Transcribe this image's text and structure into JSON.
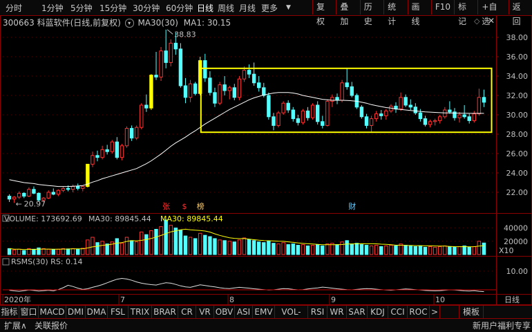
{
  "toolbar": {
    "periods": [
      "分时",
      "1分钟",
      "5分钟",
      "15分钟",
      "30分钟",
      "60分钟",
      "日线",
      "周线",
      "月线",
      "更多"
    ],
    "active_period": "日线",
    "right_buttons": [
      "复权",
      "叠加",
      "历史",
      "统计",
      "画线",
      "F10",
      "标记",
      "+自选",
      "返回"
    ]
  },
  "info": {
    "stock": "300663 科蓝软件(日线,前复权)",
    "ma_label": "MA30(30)",
    "ma_value": "MA1: 30.15"
  },
  "chart_labels": {
    "high_label": "38.83",
    "low_label": "20.97",
    "markers": [
      {
        "text": "张",
        "color": "#ff3333"
      },
      {
        "text": "$",
        "color": "#ff3333"
      },
      {
        "text": "榜",
        "color": "#ffcc66"
      },
      {
        "text": "财",
        "color": "#66ccff"
      }
    ],
    "volume_line": "VOLUME: 173692.69  MA30: 89845.44",
    "volume_ma2": "MA30: 89845.44",
    "rsms_line": "RSMS(30)  RS: 0.14",
    "x10": "X10",
    "months": [
      "2020年",
      "7",
      "8",
      "9",
      "10"
    ],
    "right_corner": "日线",
    "vol_axis": [
      "40000",
      "20000"
    ],
    "rs_axis": [
      "10.00"
    ]
  },
  "chart_data": {
    "type": "candlestick",
    "title": "300663 科蓝软件(日线,前复权)",
    "ylim": [
      20,
      39
    ],
    "y_ticks": [
      38,
      36,
      34,
      32,
      30,
      28,
      26,
      24,
      22
    ],
    "candles": [
      [
        21.6,
        21.8,
        21.0,
        21.3
      ],
      [
        21.3,
        21.6,
        20.9,
        21.5
      ],
      [
        21.5,
        22.1,
        21.3,
        21.9
      ],
      [
        21.9,
        22.0,
        21.4,
        21.6
      ],
      [
        21.6,
        22.5,
        21.5,
        22.3
      ],
      [
        22.3,
        22.6,
        21.8,
        21.9
      ],
      [
        21.9,
        22.0,
        21.0,
        21.2
      ],
      [
        21.2,
        21.5,
        20.97,
        21.4
      ],
      [
        21.4,
        22.2,
        21.3,
        22.0
      ],
      [
        22.0,
        22.4,
        21.7,
        21.8
      ],
      [
        21.8,
        22.3,
        21.6,
        22.2
      ],
      [
        22.2,
        22.6,
        22.0,
        22.4
      ],
      [
        22.4,
        22.7,
        22.1,
        22.3
      ],
      [
        22.3,
        22.8,
        22.0,
        22.6
      ],
      [
        22.6,
        22.9,
        22.2,
        22.4
      ],
      [
        22.4,
        22.7,
        22.1,
        22.6
      ],
      [
        22.6,
        24.9,
        22.5,
        24.9
      ],
      [
        24.9,
        26.2,
        24.6,
        25.8
      ],
      [
        25.8,
        26.3,
        25.2,
        25.6
      ],
      [
        25.6,
        26.8,
        25.4,
        26.4
      ],
      [
        26.4,
        26.9,
        25.9,
        26.2
      ],
      [
        26.2,
        27.4,
        26.0,
        27.2
      ],
      [
        27.2,
        27.7,
        25.4,
        25.6
      ],
      [
        25.6,
        27.0,
        25.3,
        26.8
      ],
      [
        26.8,
        28.8,
        26.6,
        28.6
      ],
      [
        28.6,
        28.9,
        27.3,
        27.6
      ],
      [
        27.6,
        28.9,
        27.4,
        28.7
      ],
      [
        28.7,
        31.2,
        28.5,
        31.0
      ],
      [
        31.0,
        32.1,
        30.3,
        30.7
      ],
      [
        30.7,
        34.2,
        30.5,
        34.1
      ],
      [
        34.1,
        36.5,
        33.6,
        33.9
      ],
      [
        33.9,
        37.0,
        33.5,
        36.6
      ],
      [
        36.6,
        38.8,
        34.8,
        35.4
      ],
      [
        35.4,
        37.8,
        35.0,
        37.4
      ],
      [
        37.4,
        38.5,
        36.2,
        36.8
      ],
      [
        36.8,
        37.4,
        32.8,
        33.0
      ],
      [
        33.0,
        33.8,
        31.2,
        31.8
      ],
      [
        31.8,
        33.6,
        31.3,
        33.2
      ],
      [
        33.2,
        33.4,
        32.0,
        32.2
      ],
      [
        32.2,
        36.0,
        32.0,
        35.6
      ],
      [
        35.6,
        36.3,
        33.4,
        33.8
      ],
      [
        33.8,
        34.5,
        32.0,
        32.3
      ],
      [
        32.3,
        32.8,
        30.8,
        31.2
      ],
      [
        31.2,
        33.4,
        31.0,
        33.1
      ],
      [
        33.1,
        34.0,
        32.0,
        32.5
      ],
      [
        32.5,
        33.0,
        31.6,
        32.8
      ],
      [
        32.8,
        33.2,
        31.5,
        31.8
      ],
      [
        31.8,
        34.0,
        31.5,
        33.7
      ],
      [
        33.7,
        35.0,
        33.4,
        34.6
      ],
      [
        34.6,
        35.2,
        33.8,
        34.2
      ],
      [
        34.2,
        35.4,
        33.0,
        33.3
      ],
      [
        33.3,
        34.0,
        32.4,
        32.8
      ],
      [
        32.8,
        33.3,
        31.8,
        32.0
      ],
      [
        32.0,
        32.3,
        29.5,
        29.8
      ],
      [
        29.8,
        30.2,
        28.4,
        28.9
      ],
      [
        28.9,
        30.4,
        28.7,
        30.2
      ],
      [
        30.2,
        31.4,
        30.0,
        31.2
      ],
      [
        31.2,
        31.5,
        30.2,
        30.5
      ],
      [
        30.5,
        30.8,
        29.3,
        29.6
      ],
      [
        29.6,
        30.0,
        28.9,
        29.2
      ],
      [
        29.2,
        30.6,
        29.0,
        30.4
      ],
      [
        30.4,
        30.8,
        29.4,
        29.7
      ],
      [
        29.7,
        31.2,
        29.5,
        31.0
      ],
      [
        31.0,
        31.4,
        29.0,
        29.3
      ],
      [
        29.3,
        29.9,
        28.6,
        28.9
      ],
      [
        28.9,
        31.6,
        28.8,
        31.4
      ],
      [
        31.4,
        32.1,
        30.8,
        31.8
      ],
      [
        31.8,
        32.2,
        31.1,
        31.5
      ],
      [
        31.5,
        33.6,
        31.3,
        33.3
      ],
      [
        33.3,
        34.8,
        32.6,
        32.9
      ],
      [
        32.9,
        33.4,
        31.8,
        32.0
      ],
      [
        32.0,
        32.2,
        30.6,
        30.8
      ],
      [
        30.8,
        31.0,
        29.6,
        29.8
      ],
      [
        29.8,
        30.1,
        28.6,
        28.9
      ],
      [
        28.9,
        29.9,
        28.2,
        29.6
      ],
      [
        29.6,
        30.4,
        29.3,
        30.1
      ],
      [
        30.1,
        30.5,
        29.5,
        29.9
      ],
      [
        29.9,
        30.6,
        29.5,
        30.4
      ],
      [
        30.4,
        31.1,
        30.2,
        30.9
      ],
      [
        30.9,
        31.3,
        30.2,
        30.6
      ],
      [
        30.6,
        32.3,
        30.4,
        31.8
      ],
      [
        31.8,
        32.1,
        30.8,
        31.0
      ],
      [
        31.0,
        31.6,
        30.5,
        30.8
      ],
      [
        30.8,
        31.2,
        30.0,
        30.2
      ],
      [
        30.2,
        30.6,
        29.3,
        29.6
      ],
      [
        29.6,
        29.9,
        28.8,
        29.0
      ],
      [
        29.0,
        29.5,
        28.7,
        29.3
      ],
      [
        29.3,
        29.6,
        28.9,
        29.4
      ],
      [
        29.4,
        30.0,
        29.1,
        29.8
      ],
      [
        29.8,
        30.8,
        29.6,
        30.5
      ],
      [
        30.5,
        31.4,
        30.1,
        30.3
      ],
      [
        30.3,
        30.7,
        29.4,
        29.7
      ],
      [
        29.7,
        30.3,
        29.2,
        30.0
      ],
      [
        30.0,
        31.0,
        29.6,
        29.8
      ],
      [
        29.8,
        30.1,
        29.1,
        29.4
      ],
      [
        29.4,
        30.4,
        29.2,
        30.1
      ],
      [
        30.1,
        32.7,
        29.9,
        31.8
      ],
      [
        31.8,
        32.6,
        30.8,
        31.3
      ]
    ],
    "ma30": [
      23.3,
      23.2,
      23.1,
      23.0,
      22.95,
      22.9,
      22.8,
      22.75,
      22.7,
      22.65,
      22.6,
      22.6,
      22.6,
      22.62,
      22.65,
      22.7,
      22.85,
      23.05,
      23.2,
      23.4,
      23.55,
      23.7,
      23.85,
      24.0,
      24.15,
      24.3,
      24.45,
      24.7,
      24.95,
      25.25,
      25.6,
      25.95,
      26.35,
      26.75,
      27.1,
      27.4,
      27.7,
      28.05,
      28.35,
      28.7,
      29.05,
      29.35,
      29.65,
      29.95,
      30.25,
      30.55,
      30.8,
      31.05,
      31.3,
      31.55,
      31.75,
      31.9,
      32.05,
      32.15,
      32.25,
      32.3,
      32.3,
      32.3,
      32.25,
      32.15,
      32.0,
      31.9,
      31.8,
      31.7,
      31.6,
      31.55,
      31.5,
      31.5,
      31.5,
      31.48,
      31.45,
      31.4,
      31.3,
      31.2,
      31.05,
      30.95,
      30.85,
      30.75,
      30.7,
      30.6,
      30.55,
      30.5,
      30.45,
      30.4,
      30.35,
      30.3,
      30.28,
      30.25,
      30.22,
      30.2,
      30.2,
      30.18,
      30.17,
      30.16,
      30.15,
      30.15,
      30.15,
      30.15
    ],
    "volume": [
      9000,
      7000,
      8000,
      6000,
      9000,
      8000,
      10000,
      9000,
      8000,
      7500,
      8000,
      9000,
      8500,
      9000,
      8000,
      9500,
      22000,
      26000,
      18000,
      20000,
      16000,
      19000,
      24000,
      17000,
      26000,
      21000,
      19000,
      34000,
      30000,
      36000,
      38000,
      42000,
      52000,
      44000,
      40000,
      37000,
      28000,
      26000,
      24000,
      32000,
      29000,
      27000,
      24000,
      22000,
      21000,
      20000,
      19000,
      22000,
      25000,
      23000,
      21000,
      19000,
      18000,
      20000,
      17000,
      16000,
      18000,
      15000,
      16000,
      14000,
      15000,
      13000,
      14000,
      15000,
      13000,
      16000,
      17000,
      15000,
      19000,
      21000,
      16000,
      17000,
      15000,
      14000,
      13000,
      14000,
      12000,
      13000,
      14000,
      13000,
      16000,
      14000,
      13000,
      12000,
      13000,
      11000,
      12000,
      11000,
      12000,
      13000,
      12000,
      11000,
      12000,
      13000,
      11000,
      12000,
      20000,
      17369
    ],
    "rs": [
      0.8,
      0.5,
      0.3,
      0.6,
      0.9,
      0.7,
      0.4,
      0.6,
      0.8,
      0.5,
      1.1,
      2.0,
      3.2,
      2.6,
      1.8,
      1.2,
      1.5,
      2.2,
      2.8,
      3.5,
      4.4,
      5.3,
      6.1,
      6.5,
      6.2,
      5.6,
      4.8,
      4.2,
      3.8,
      3.5,
      3.3,
      3.9,
      4.4,
      4.2,
      3.6,
      2.9,
      2.4,
      2.2,
      2.8,
      3.4,
      3.1,
      2.7,
      2.4,
      2.0,
      1.7,
      1.6,
      1.9,
      2.2,
      2.0,
      1.8,
      1.5,
      1.3,
      1.1,
      0.9,
      1.0,
      1.3,
      1.6,
      1.5,
      1.2,
      1.0,
      1.1,
      1.4,
      1.7,
      1.9,
      2.3,
      2.1,
      1.8,
      1.5,
      1.3,
      1.1,
      1.0,
      1.2,
      1.4,
      1.6,
      1.5,
      1.3,
      1.1,
      0.9,
      0.8,
      1.0,
      1.2,
      1.4,
      1.3,
      1.1,
      0.9,
      0.7,
      0.6,
      0.5,
      0.6,
      0.8,
      1.0,
      0.9,
      0.7,
      0.5,
      0.4,
      0.6,
      0.3,
      0.14
    ]
  },
  "bottom_tabs": [
    "指标",
    "窗口",
    "MACD",
    "DMI",
    "DMA",
    "FSL",
    "TRIX",
    "BRAR",
    "CR",
    "VR",
    "OBV",
    "ASI",
    "EMV",
    "VOL-TDX",
    "RSI",
    "WR",
    "SAR",
    "KDJ",
    "CCI",
    "ROC"
  ],
  "bottom_right": "模板",
  "status": {
    "left1": "扩展∧",
    "left2": "关联报价",
    "right": "新用户福利专享"
  }
}
